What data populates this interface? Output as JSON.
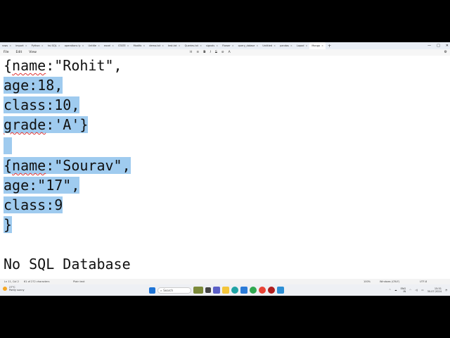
{
  "tabs": [
    {
      "label": "rows"
    },
    {
      "label": "import"
    },
    {
      "label": "Python"
    },
    {
      "label": "hsi SQL"
    },
    {
      "label": "operations ly"
    },
    {
      "label": "Untitle"
    },
    {
      "label": "excel"
    },
    {
      "label": "STATE"
    },
    {
      "label": "Modifo"
    },
    {
      "label": "demo.txt"
    },
    {
      "label": "test.txt"
    },
    {
      "label": "Queries.txt"
    },
    {
      "label": "signals"
    },
    {
      "label": "Flower"
    },
    {
      "label": "query_datase"
    },
    {
      "label": "Untitled"
    },
    {
      "label": "pandas"
    },
    {
      "label": "Lopod"
    },
    {
      "label": "Mongo",
      "active": true
    }
  ],
  "window_controls": {
    "minimize": "—",
    "maximize": "□",
    "close": "✕"
  },
  "menu": [
    "File",
    "Edit",
    "View"
  ],
  "format_toolbar": [
    "H",
    "≡",
    "B",
    "I",
    "S",
    "⊘",
    "A"
  ],
  "editor": {
    "lines": [
      {
        "prefix": "{",
        "word": "name",
        "suffix": ":\"Rohit\",",
        "selected": false
      },
      {
        "text": "age:18,",
        "selected": true
      },
      {
        "text": "class:10,",
        "selected": true
      },
      {
        "prefix": "",
        "word": "grade",
        "suffix": ":'A'}",
        "selected": true
      },
      {
        "text": " ",
        "selected": true
      },
      {
        "prefix": "{",
        "word": "name",
        "suffix": ":\"Sourav\",",
        "selected": true
      },
      {
        "text": "age:\"17\",",
        "selected": true
      },
      {
        "text": "class:9",
        "selected": true
      },
      {
        "text": "}",
        "selected": true
      },
      {
        "text": "",
        "selected": false
      },
      {
        "text": "No SQL Database",
        "selected": false
      }
    ]
  },
  "status": {
    "position": "Ln 11, Col 2",
    "chars": "61 of 272 characters",
    "format": "Plain text",
    "zoom": "100%",
    "line_ending": "Windows (CRLF)",
    "encoding": "UTF-8"
  },
  "taskbar": {
    "weather_temp": "27°C",
    "weather_desc": "Partly sunny",
    "search_placeholder": "Search",
    "lang_top": "ENG",
    "lang_bottom": "IN",
    "time": "15:51",
    "date": "30-07-2024"
  }
}
